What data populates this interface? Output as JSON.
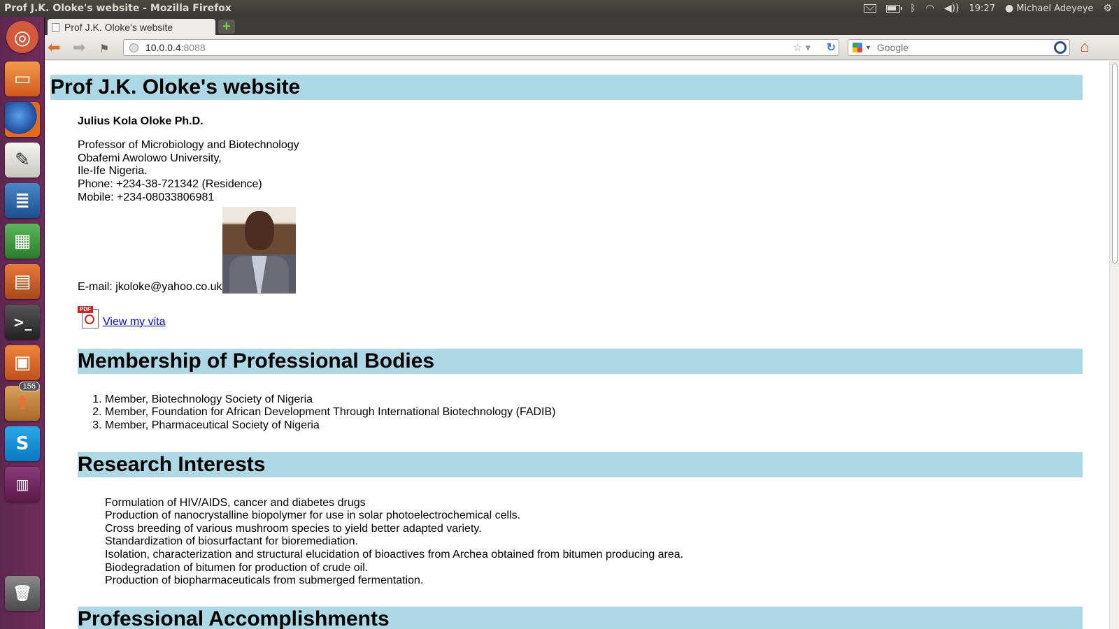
{
  "panel": {
    "window_title": "Prof J.K. Oloke's website - Mozilla Firefox",
    "time": "19:27",
    "user": "Michael Adeyeye"
  },
  "launcher": {
    "items": [
      "ubuntu-logo",
      "files",
      "firefox",
      "text-editor",
      "writer",
      "calc",
      "impress",
      "terminal",
      "software-center",
      "update-manager",
      "skype",
      "workspaces",
      "trash"
    ],
    "update_badge": "156"
  },
  "browser": {
    "tab_title": "Prof J.K. Oloke's website",
    "url_host": "10.0.0.4",
    "url_port": ":8088",
    "search_placeholder": "Google"
  },
  "page": {
    "title": "Prof J.K. Oloke's website",
    "name": "Julius Kola Oloke Ph.D.",
    "address": [
      "Professor of Microbiology and Biotechnology",
      "Obafemi Awolowo University,",
      "Ile-Ife Nigeria.",
      "Phone: +234-38-721342 (Residence)",
      "Mobile: +234-08033806981"
    ],
    "email": "E-mail: jkoloke@yahoo.co.uk",
    "vita_link": "View my vita",
    "membership_heading": "Membership of Professional Bodies",
    "memberships": [
      "Member, Biotechnology Society of Nigeria",
      "Member, Foundation for African Development Through International Biotechnology (FADIB)",
      "Member, Pharmaceutical Society of Nigeria"
    ],
    "research_heading": "Research Interests",
    "research": [
      "Formulation of HIV/AIDS, cancer and diabetes drugs",
      "Production of nanocrystalline biopolymer for use in solar photoelectrochemical cells.",
      "Cross breeding of various mushroom species to yield better adapted variety.",
      "Standardization of biosurfactant for bioremediation.",
      "Isolation, characterization and structural elucidation of bioactives from Archea obtained from bitumen producing area.",
      "Biodegradation of bitumen for production of crude oil.",
      "Production of biopharmaceuticals from submerged fermentation."
    ],
    "accomplishments_heading": "Professional Accomplishments"
  }
}
